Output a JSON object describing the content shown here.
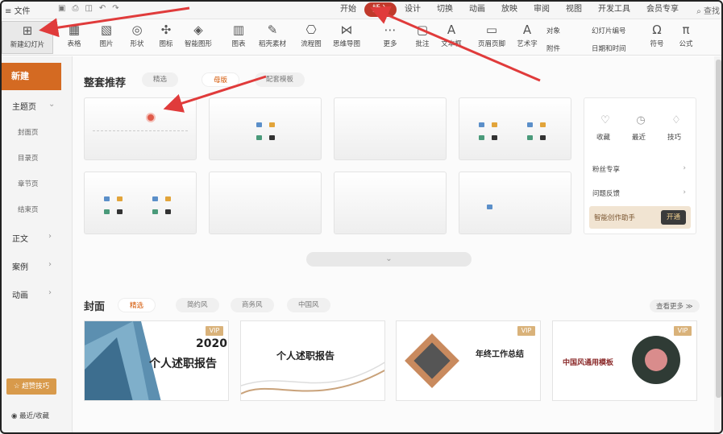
{
  "menubar": {
    "file": "文件",
    "tabs": [
      "开始",
      "插入",
      "设计",
      "切换",
      "动画",
      "放映",
      "审阅",
      "视图",
      "开发工具",
      "会员专享"
    ],
    "active": "插入",
    "search": "查找"
  },
  "ribbon": {
    "first_label": "新建幻灯片",
    "buttons": [
      {
        "icon": "▦",
        "label": "表格"
      },
      {
        "icon": "▧",
        "label": "图片"
      },
      {
        "icon": "◎",
        "label": "形状"
      },
      {
        "icon": "✣",
        "label": "图标"
      },
      {
        "icon": "◈",
        "label": "智能图形"
      },
      {
        "icon": "▥",
        "label": "图表"
      },
      {
        "icon": "✎",
        "label": "稻壳素材"
      },
      {
        "icon": "⎔",
        "label": "流程图"
      },
      {
        "icon": "⋈",
        "label": "思维导图"
      },
      {
        "icon": "⋯",
        "label": "更多"
      },
      {
        "icon": "▢",
        "label": "批注"
      },
      {
        "icon": "A",
        "label": "文本框"
      },
      {
        "icon": "▭",
        "label": "页眉页脚"
      },
      {
        "icon": "A",
        "label": "艺术字"
      }
    ],
    "small": [
      "对象",
      "幻灯片编号",
      "附件",
      "日期和时间"
    ],
    "right": [
      {
        "icon": "Ω",
        "label": "符号"
      },
      {
        "icon": "π",
        "label": "公式"
      }
    ]
  },
  "sidebar": {
    "new": "新建",
    "theme": "主题页",
    "subs": [
      "封面页",
      "目录页",
      "章节页",
      "结束页"
    ],
    "items": [
      "正文",
      "案例",
      "动画"
    ],
    "vip": "超赞技巧",
    "recent": "最近/收藏"
  },
  "main": {
    "title": "整套推荐",
    "pills": [
      "精选",
      "母版",
      "配套模板"
    ],
    "active_pill": "母版",
    "panel": {
      "icons": [
        {
          "icon": "♡",
          "label": "收藏"
        },
        {
          "icon": "◷",
          "label": "最近"
        },
        {
          "icon": "♢",
          "label": "技巧"
        }
      ],
      "rows": [
        "粉丝专享",
        "问题反馈"
      ],
      "ai": "智能创作助手",
      "ai_btn": "开通"
    },
    "cover_title": "封面",
    "cover_pills": [
      "精选",
      "简约风",
      "商务风",
      "中国风"
    ],
    "more": "查看更多",
    "covers": [
      {
        "year": "2020",
        "title": "个人述职报告",
        "vip": "VIP"
      },
      {
        "title": "个人述职报告"
      },
      {
        "title": "年终工作总结",
        "vip": "VIP"
      },
      {
        "title": "中国风通用模板",
        "vip": "VIP"
      }
    ]
  },
  "colors": {
    "accent": "#d46a22",
    "active_tab": "#c0392b",
    "arrow": "#e03b3b"
  }
}
